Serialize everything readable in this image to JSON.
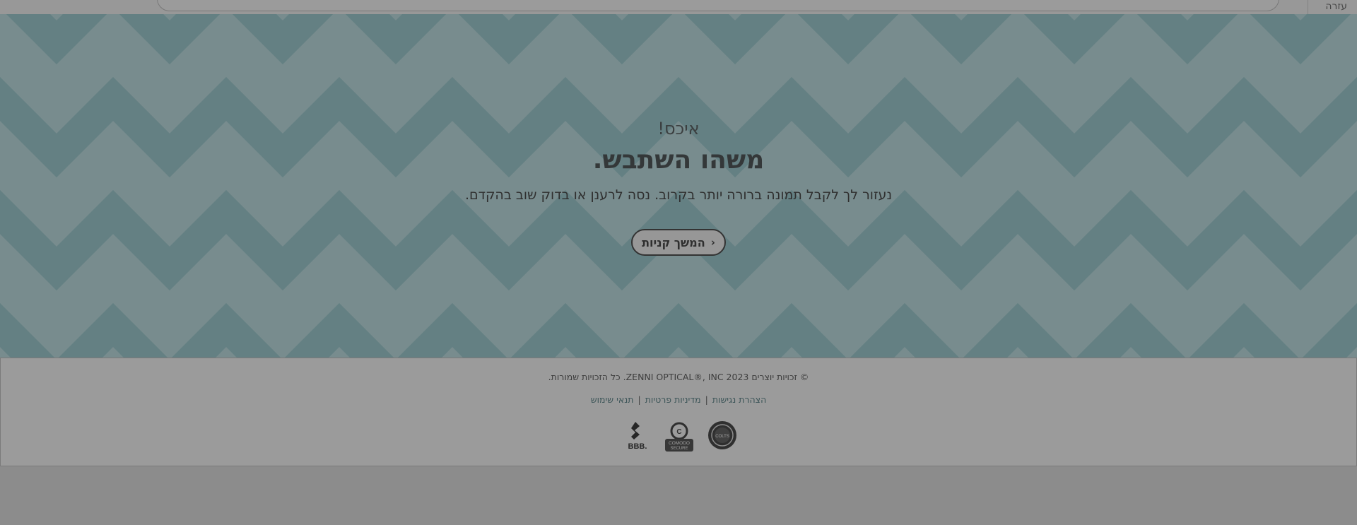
{
  "header": {
    "help_label": "עזרה"
  },
  "error_page": {
    "oops": "איכס!",
    "headline": "משהו השתבש.",
    "message": "נעזור לך לקבל תמונה ברורה יותר בקרוב. נסה לרענן או בדוק שוב בהקדם.",
    "continue_label": "המשך קניות"
  },
  "footer": {
    "copyright": "© זכויות יוצרים ZENNI OPTICAL®, INC 2023. כל הזכויות שמורות.",
    "links": [
      {
        "label": "הצהרת נגישות"
      },
      {
        "label": "מדיניות פרטיות"
      },
      {
        "label": "תנאי שימוש"
      }
    ],
    "separator": "|",
    "badges": [
      {
        "name": "colts-seal",
        "text": "COLTS"
      },
      {
        "name": "comodo-secure",
        "text": "COMODO SECURE"
      },
      {
        "name": "bbb",
        "text": "BBB."
      }
    ]
  },
  "colors": {
    "pattern_light": "#b5dde1",
    "pattern_dark": "#8dc5cb",
    "overlay": "rgba(60,60,60,0.5)",
    "link": "#3c6e74"
  }
}
